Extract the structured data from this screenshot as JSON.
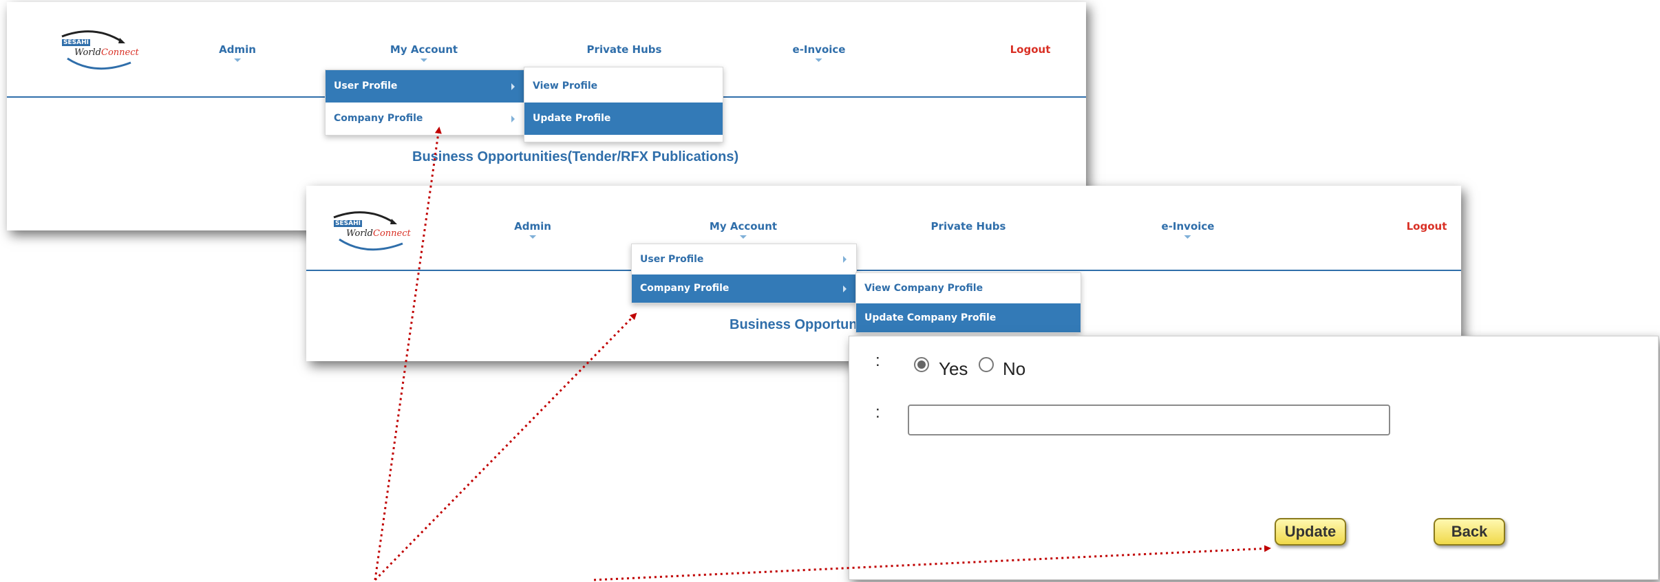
{
  "header1": {
    "logo": {
      "line1": "SESAHI",
      "line2a": "World",
      "line2b": "Connect"
    },
    "nav": [
      {
        "label": "Admin"
      },
      {
        "label": "My Account"
      },
      {
        "label": "Private Hubs"
      },
      {
        "label": "e-Invoice"
      },
      {
        "label": "Logout"
      }
    ],
    "menu": [
      {
        "label": "User Profile",
        "active": true
      },
      {
        "label": "Company Profile",
        "active": false
      }
    ],
    "submenu": [
      {
        "label": "View Profile",
        "active": false
      },
      {
        "label": "Update Profile",
        "active": true
      }
    ],
    "heading": "Business Opportunities(Tender/RFX Publications)"
  },
  "header2": {
    "logo": {
      "line1": "SESAHI",
      "line2a": "World",
      "line2b": "Connect"
    },
    "nav": [
      {
        "label": "Admin"
      },
      {
        "label": "My Account"
      },
      {
        "label": "Private Hubs"
      },
      {
        "label": "e-Invoice"
      },
      {
        "label": "Logout"
      }
    ],
    "menu": [
      {
        "label": "User Profile",
        "active": false
      },
      {
        "label": "Company Profile",
        "active": true
      }
    ],
    "submenu": [
      {
        "label": "View Company Profile",
        "active": false
      },
      {
        "label": "Update Company Profile",
        "active": true
      }
    ],
    "heading": "Business Opportuni"
  },
  "form": {
    "colon": ":",
    "radio_yes": "Yes",
    "radio_no": "No",
    "selected": "Yes",
    "text_value": "",
    "update_label": "Update",
    "back_label": "Back"
  },
  "colors": {
    "brand_blue": "#2f6eaa",
    "menu_active": "#337ab7",
    "logout_red": "#d93025",
    "arrow_red": "#c00000",
    "button_yellow": "#f0d94a"
  }
}
